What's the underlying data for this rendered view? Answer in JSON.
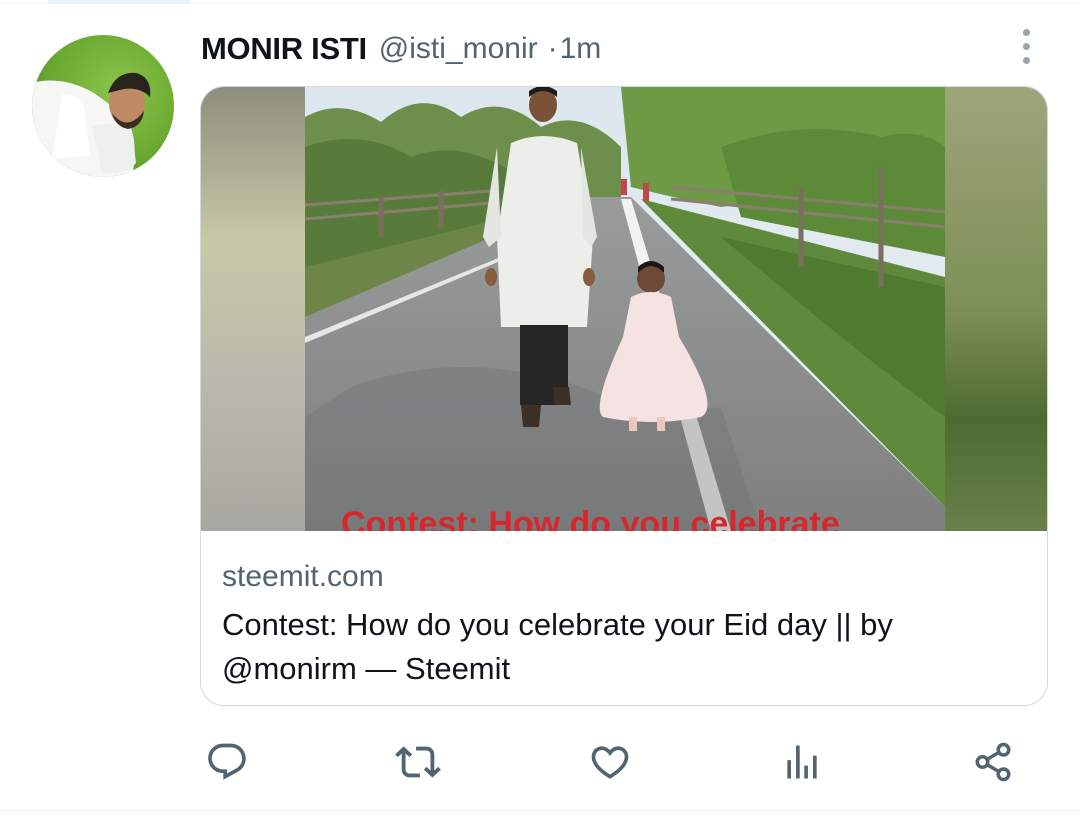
{
  "tweet": {
    "author": {
      "display_name": "MONIR ISTI",
      "handle": "@isti_monir",
      "separator": "·",
      "timestamp": "1m"
    },
    "link_card": {
      "image_overlay_text": "Contest: How do you celebrate",
      "domain": "steemit.com",
      "title": "Contest: How do you celebrate your Eid day || by @monirm — Steemit"
    },
    "actions": [
      {
        "icon": "reply-icon"
      },
      {
        "icon": "retweet-icon"
      },
      {
        "icon": "like-icon"
      },
      {
        "icon": "views-icon"
      },
      {
        "icon": "share-icon"
      }
    ]
  },
  "colors": {
    "primary_text": "#0f1419",
    "secondary_text": "#536471",
    "icon": "#536471",
    "border": "#cfd9de",
    "overlay_text": "#d7262c"
  }
}
